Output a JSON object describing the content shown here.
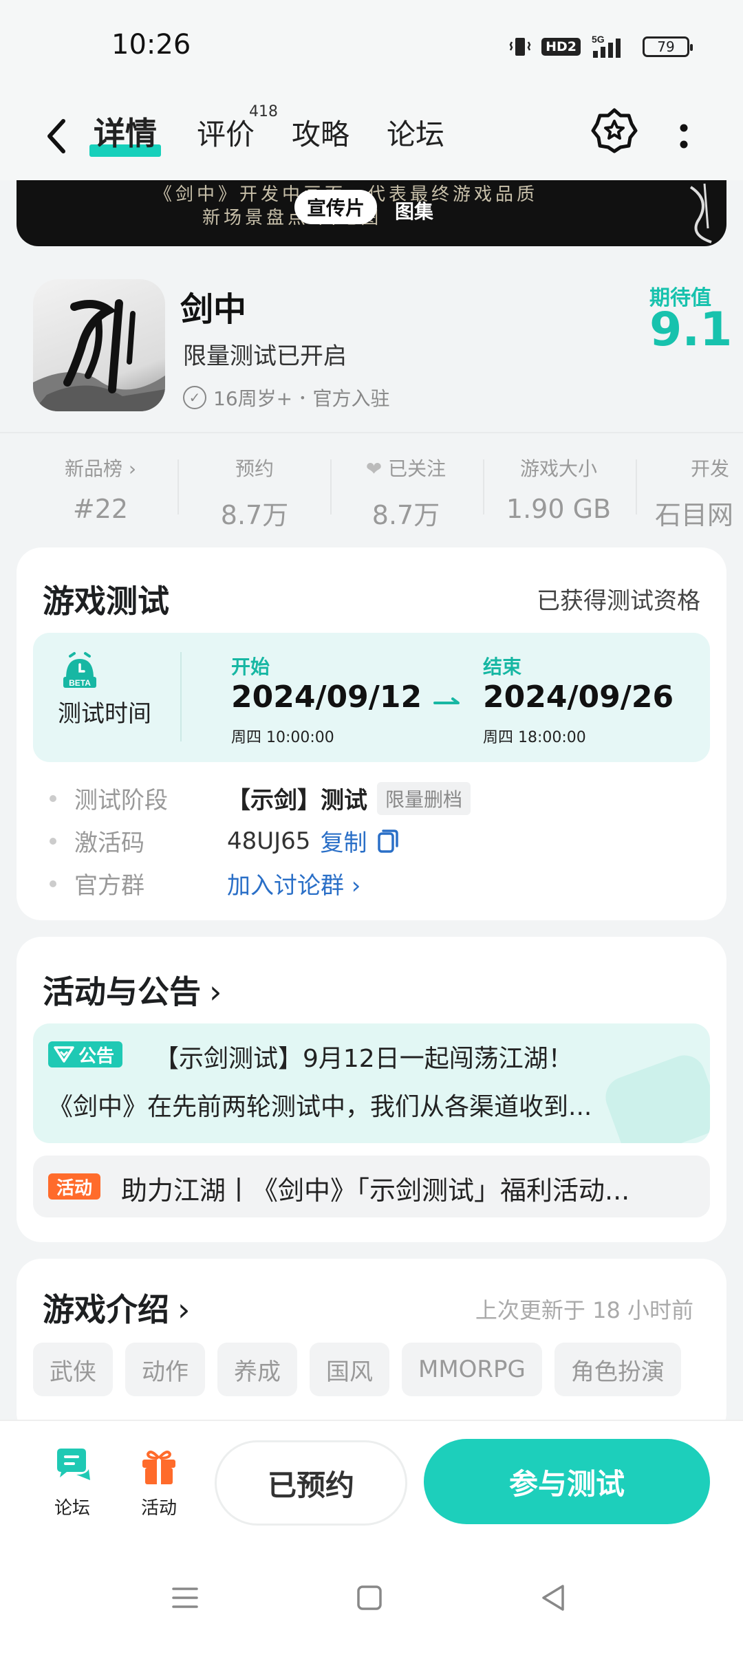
{
  "status": {
    "time": "10:26",
    "network": "5G",
    "hd": "HD2",
    "battery": "79"
  },
  "nav": {
    "tabs": [
      {
        "label": "详情",
        "active": true
      },
      {
        "label": "评价",
        "badge": "418"
      },
      {
        "label": "攻略"
      },
      {
        "label": "论坛"
      }
    ]
  },
  "banner": {
    "text_line1": "《剑中》开发中画面，代表最终游戏品质",
    "text_line2": "新场景盘点                    田地图",
    "tabs": [
      "宣传片",
      "图集"
    ]
  },
  "game": {
    "title": "剑中",
    "subtitle": "限量测试已开启",
    "age_rating": "16周岁+",
    "separator": "•",
    "official": "官方入驻",
    "expect_label": "期待值",
    "expect_score": "9.1",
    "icon_glyph": "剑"
  },
  "stats": [
    {
      "label": "新品榜 ›",
      "value": "#22"
    },
    {
      "label": "预约",
      "value": "8.7万"
    },
    {
      "label": "已关注",
      "value": "8.7万"
    },
    {
      "label": "游戏大小",
      "value": "1.90 GB"
    },
    {
      "label": "开发",
      "value": "石目网"
    }
  ],
  "test": {
    "title": "游戏测试",
    "status": "已获得测试资格",
    "time_label": "测试时间",
    "beta_text": "BETA",
    "start_label": "开始",
    "start_date": "2024/09/12",
    "start_sub": "周四  10:00:00",
    "end_label": "结束",
    "end_date": "2024/09/26",
    "end_sub": "周四  18:00:00",
    "rows": {
      "stage_label": "测试阶段",
      "stage_value": "【示剑】测试",
      "stage_tag": "限量删档",
      "code_label": "激活码",
      "code_value": "48UJ65",
      "copy_label": "复制",
      "group_label": "官方群",
      "group_link": "加入讨论群 ›"
    }
  },
  "activity": {
    "title": "活动与公告",
    "notice_badge": "公告",
    "notice_line1": "【示剑测试】9月12日一起闯荡江湖！",
    "notice_line2": "《剑中》在先前两轮测试中，我们从各渠道收到...",
    "event_badge": "活动",
    "event_text": "助力江湖丨《剑中》「示剑测试」福利活动..."
  },
  "intro": {
    "title": "游戏介绍",
    "updated": "上次更新于 18 小时前",
    "tags": [
      "武侠",
      "动作",
      "养成",
      "国风",
      "MMORPG",
      "角色扮演"
    ]
  },
  "bottom": {
    "forum_label": "论坛",
    "event_label": "活动",
    "reserved_label": "已预约",
    "join_label": "参与测试"
  },
  "colors": {
    "accent": "#1dcfbb",
    "accent_dark": "#17b7a3",
    "event": "#ff6b2b",
    "link": "#2a6fc7"
  }
}
